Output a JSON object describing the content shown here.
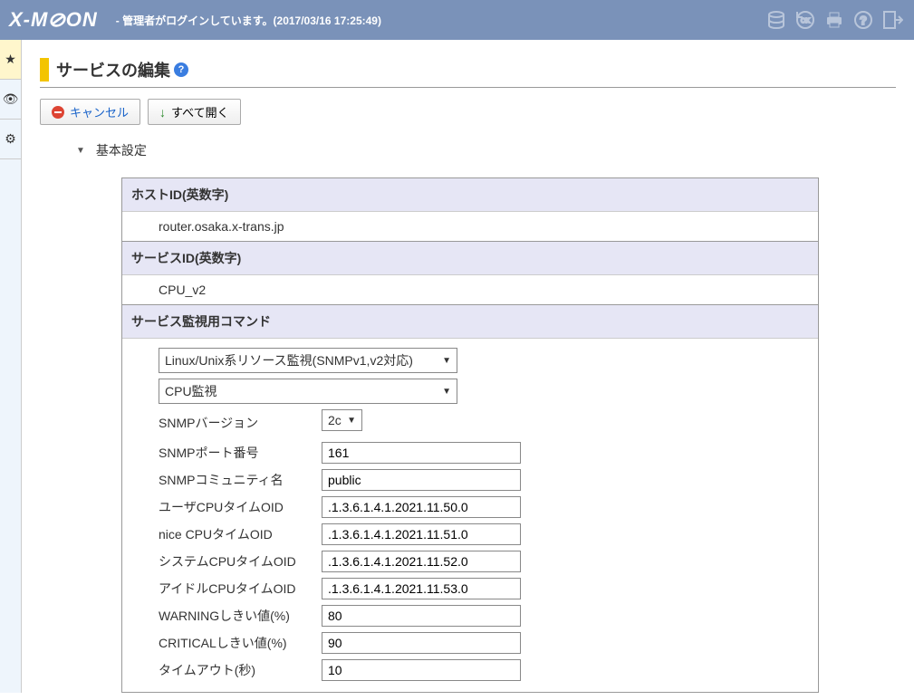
{
  "header": {
    "logo": "X-M⊘ON",
    "login_info": "- 管理者がログインしています。(2017/03/16 17:25:49)"
  },
  "sidebar": {
    "tabs": [
      "★",
      "👁",
      "⚙"
    ]
  },
  "page": {
    "title": "サービスの編集",
    "help": "?"
  },
  "toolbar": {
    "cancel": "キャンセル",
    "expand_all": "すべて開く"
  },
  "section": {
    "basic": "基本設定"
  },
  "form": {
    "host_id_label": "ホストID(英数字)",
    "host_id_value": "router.osaka.x-trans.jp",
    "service_id_label": "サービスID(英数字)",
    "service_id_value": "CPU_v2",
    "command_label": "サービス監視用コマンド",
    "command_select1": "Linux/Unix系リソース監視(SNMPv1,v2対応)",
    "command_select2": "CPU監視",
    "params": {
      "snmp_version_label": "SNMPバージョン",
      "snmp_version_value": "2c",
      "snmp_port_label": "SNMPポート番号",
      "snmp_port_value": "161",
      "snmp_community_label": "SNMPコミュニティ名",
      "snmp_community_value": "public",
      "user_cpu_oid_label": "ユーザCPUタイムOID",
      "user_cpu_oid_value": ".1.3.6.1.4.1.2021.11.50.0",
      "nice_cpu_oid_label": "nice CPUタイムOID",
      "nice_cpu_oid_value": ".1.3.6.1.4.1.2021.11.51.0",
      "system_cpu_oid_label": "システムCPUタイムOID",
      "system_cpu_oid_value": ".1.3.6.1.4.1.2021.11.52.0",
      "idle_cpu_oid_label": "アイドルCPUタイムOID",
      "idle_cpu_oid_value": ".1.3.6.1.4.1.2021.11.53.0",
      "warning_label": "WARNINGしきい値(%)",
      "warning_value": "80",
      "critical_label": "CRITICALしきい値(%)",
      "critical_value": "90",
      "timeout_label": "タイムアウト(秒)",
      "timeout_value": "10"
    }
  }
}
